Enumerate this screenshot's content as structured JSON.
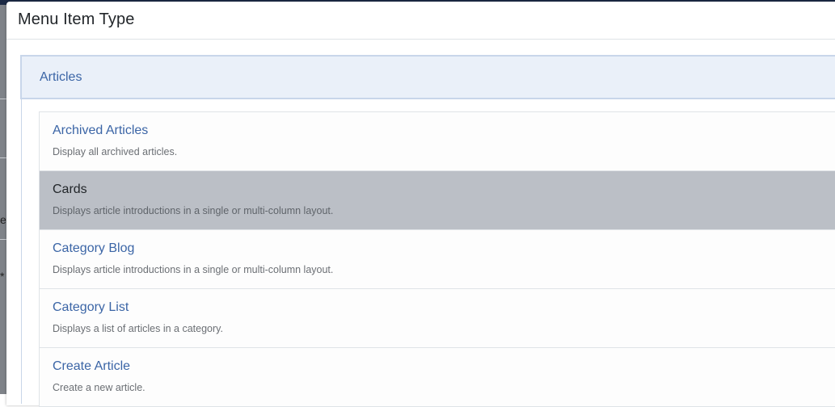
{
  "modal": {
    "title": "Menu Item Type"
  },
  "accordion": {
    "title": "Articles"
  },
  "items": [
    {
      "title": "Archived Articles",
      "description": "Display all archived articles."
    },
    {
      "title": "Cards",
      "description": "Displays article introductions in a single or multi-column layout.",
      "selected": true
    },
    {
      "title": "Category Blog",
      "description": "Displays article introductions in a single or multi-column layout."
    },
    {
      "title": "Category List",
      "description": "Displays a list of articles in a category."
    },
    {
      "title": "Create Article",
      "description": "Create a new article."
    }
  ],
  "background": {
    "glyph_1": "e",
    "glyph_2": "*"
  },
  "colors": {
    "link": "#3b65a6",
    "accordion_bg": "#eaf0f9",
    "selected_bg": "#bbbfc6"
  }
}
